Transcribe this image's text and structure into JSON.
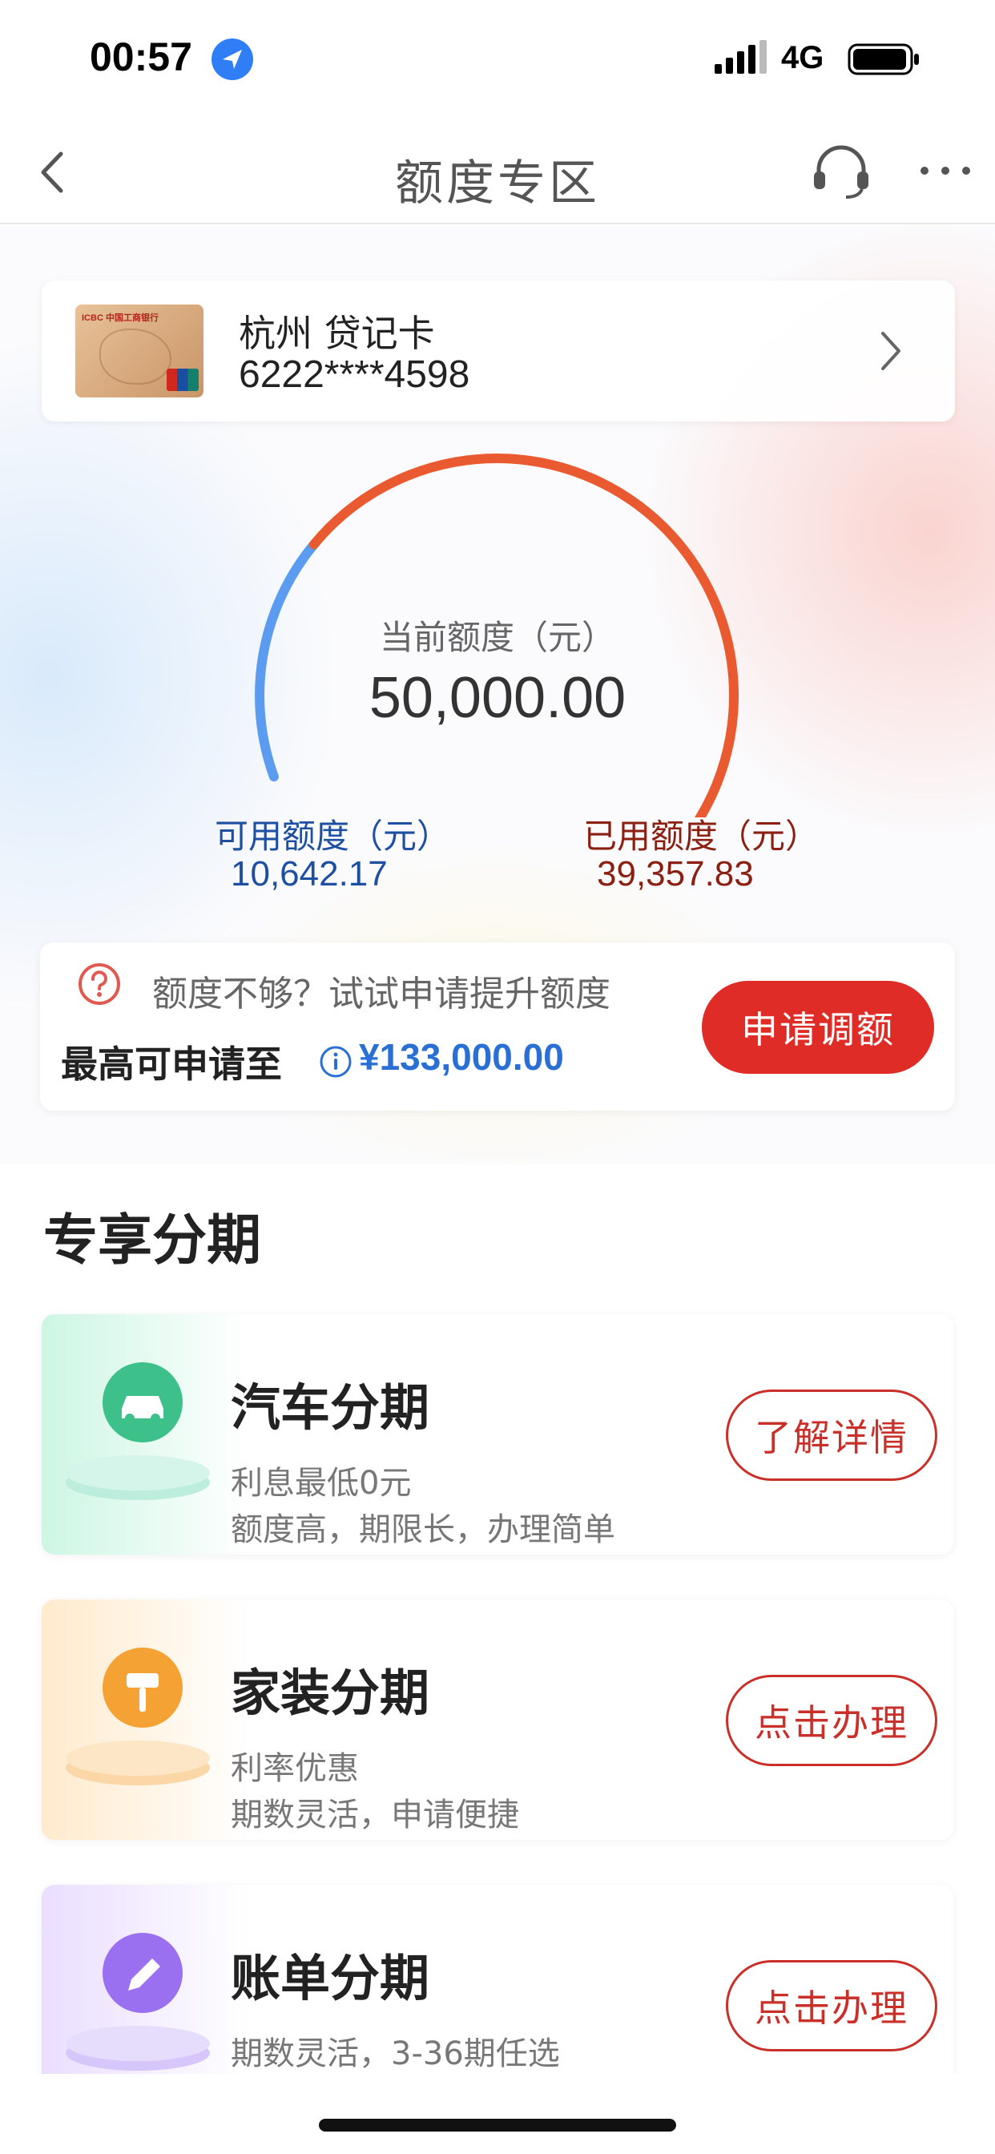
{
  "status_bar": {
    "time": "00:57",
    "network": "4G"
  },
  "nav": {
    "title": "额度专区",
    "back_icon": "chevron-left-icon",
    "service_icon": "headset-icon",
    "more_icon": "more-dots-icon"
  },
  "card": {
    "name": "杭州 贷记卡",
    "number": "6222****4598",
    "thumb_bank_text": "ICBC 中国工商银行"
  },
  "quota": {
    "current_label": "当前额度（元）",
    "current_value": "50,000.00",
    "available_label": "可用额度（元）",
    "available_value": "10,642.17",
    "used_label": "已用额度（元）",
    "used_value": "39,357.83",
    "available_fraction": 0.2128,
    "colors": {
      "available": "#5b9cf0",
      "used": "#ea5a30"
    }
  },
  "raise": {
    "hint": "额度不够？试试申请提升额度",
    "max_label": "最高可申请至",
    "max_value": "¥133,000.00",
    "button": "申请调额"
  },
  "section": {
    "title": "专享分期"
  },
  "products": [
    {
      "title": "汽车分期",
      "sub1": "利息最低0元",
      "sub2": "额度高，期限长，办理简单",
      "button": "了解详情",
      "icon": "car-icon",
      "color": "#3ec08a"
    },
    {
      "title": "家装分期",
      "sub1": "利率优惠",
      "sub2": "期数灵活，申请便捷",
      "button": "点击办理",
      "icon": "paint-roller-icon",
      "color": "#f4a233"
    },
    {
      "title": "账单分期",
      "sub1": "期数灵活，3-36期任选",
      "sub2": "",
      "button": "点击办理",
      "icon": "pencil-icon",
      "color": "#9a6ff0"
    }
  ]
}
